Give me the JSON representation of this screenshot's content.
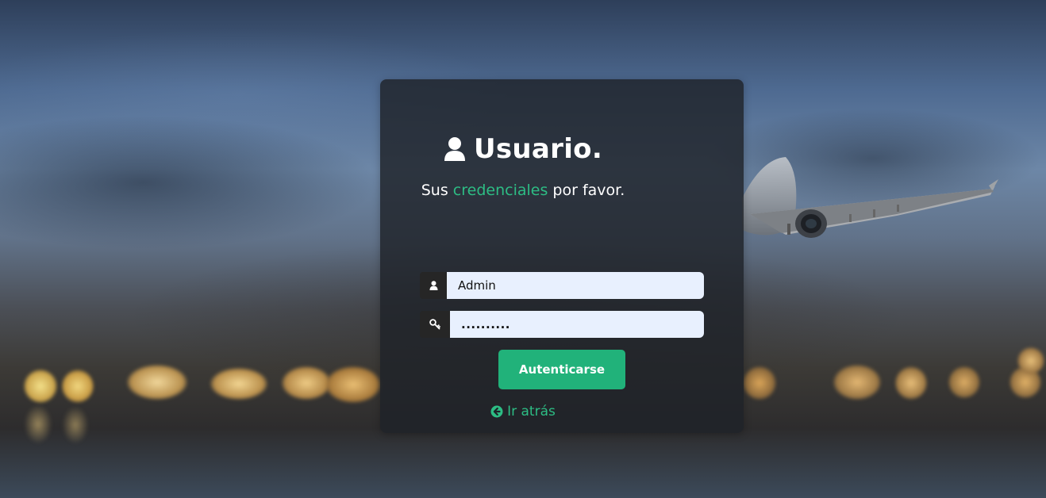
{
  "login": {
    "title": "Usuario.",
    "subtitle_prefix": "Sus",
    "subtitle_accent": "credenciales",
    "subtitle_suffix": "por favor.",
    "username_value": "Admin",
    "password_value": "..........",
    "submit_label": "Autenticarse",
    "back_label": "Ir atrás"
  },
  "icons": {
    "title": "user-icon",
    "username": "user-icon",
    "password": "key-icon",
    "back": "circle-arrow-left-icon"
  },
  "colors": {
    "accent": "#2dbd84",
    "button": "#21b27a",
    "card": "#1e2228",
    "input_bg": "#e8f0fe"
  }
}
